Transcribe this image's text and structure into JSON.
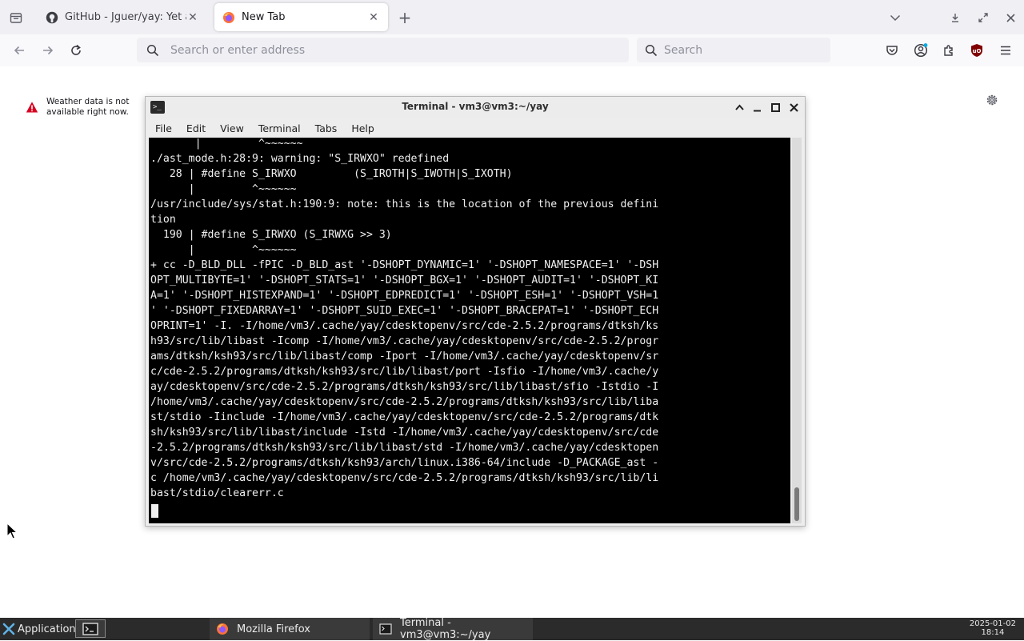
{
  "browser": {
    "tabs": [
      {
        "title": "GitHub - Jguer/yay: Yet another Yogurt - An AUR Helper written in Go",
        "favicon": "github-icon",
        "active": false
      },
      {
        "title": "New Tab",
        "favicon": "firefox-icon",
        "active": true
      }
    ],
    "urlbar": {
      "placeholder": "Search or enter address",
      "value": ""
    },
    "searchbar": {
      "placeholder": "Search",
      "value": ""
    },
    "toolbar_icons": [
      "back-icon",
      "forward-icon",
      "reload-icon",
      "pocket-icon",
      "account-icon",
      "extensions-icon",
      "ublock-icon",
      "menu-icon"
    ]
  },
  "newtab": {
    "weather_message": "Weather data is not available right now."
  },
  "terminal": {
    "title": "Terminal - vm3@vm3:~/yay",
    "menu": [
      "File",
      "Edit",
      "View",
      "Terminal",
      "Tabs",
      "Help"
    ],
    "lines": [
      "       |         ^~~~~~~",
      "./ast_mode.h:28:9: warning: \"S_IRWXO\" redefined",
      "   28 | #define S_IRWXO         (S_IROTH|S_IWOTH|S_IXOTH)",
      "      |         ^~~~~~~",
      "/usr/include/sys/stat.h:190:9: note: this is the location of the previous defini",
      "tion",
      "  190 | #define S_IRWXO (S_IRWXG >> 3)",
      "      |         ^~~~~~~",
      "+ cc -D_BLD_DLL -fPIC -D_BLD_ast '-DSHOPT_DYNAMIC=1' '-DSHOPT_NAMESPACE=1' '-DSH",
      "OPT_MULTIBYTE=1' '-DSHOPT_STATS=1' '-DSHOPT_BGX=1' '-DSHOPT_AUDIT=1' '-DSHOPT_KI",
      "A=1' '-DSHOPT_HISTEXPAND=1' '-DSHOPT_EDPREDICT=1' '-DSHOPT_ESH=1' '-DSHOPT_VSH=1",
      "' '-DSHOPT_FIXEDARRAY=1' '-DSHOPT_SUID_EXEC=1' '-DSHOPT_BRACEPAT=1' '-DSHOPT_ECH",
      "OPRINT=1' -I. -I/home/vm3/.cache/yay/cdesktopenv/src/cde-2.5.2/programs/dtksh/ks",
      "h93/src/lib/libast -Icomp -I/home/vm3/.cache/yay/cdesktopenv/src/cde-2.5.2/progr",
      "ams/dtksh/ksh93/src/lib/libast/comp -Iport -I/home/vm3/.cache/yay/cdesktopenv/sr",
      "c/cde-2.5.2/programs/dtksh/ksh93/src/lib/libast/port -Isfio -I/home/vm3/.cache/y",
      "ay/cdesktopenv/src/cde-2.5.2/programs/dtksh/ksh93/src/lib/libast/sfio -Istdio -I",
      "/home/vm3/.cache/yay/cdesktopenv/src/cde-2.5.2/programs/dtksh/ksh93/src/lib/liba",
      "st/stdio -Iinclude -I/home/vm3/.cache/yay/cdesktopenv/src/cde-2.5.2/programs/dtk",
      "sh/ksh93/src/lib/libast/include -Istd -I/home/vm3/.cache/yay/cdesktopenv/src/cde",
      "-2.5.2/programs/dtksh/ksh93/src/lib/libast/std -I/home/vm3/.cache/yay/cdesktopen",
      "v/src/cde-2.5.2/programs/dtksh/ksh93/arch/linux.i386-64/include -D_PACKAGE_ast -",
      "c /home/vm3/.cache/yay/cdesktopenv/src/cde-2.5.2/programs/dtksh/ksh93/src/lib/li",
      "bast/stdio/clearerr.c"
    ]
  },
  "taskbar": {
    "applications_label": "Applications",
    "tasks": [
      {
        "label": "Mozilla Firefox",
        "icon": "firefox-icon"
      },
      {
        "label": "Terminal - vm3@vm3:~/yay",
        "icon": "terminal-icon"
      }
    ],
    "clock_date": "2025-01-02",
    "clock_time": "18:14"
  },
  "colors": {
    "tabstrip_bg": "#f0f0f4",
    "terminal_bg": "#000000",
    "terminal_fg": "#f0f0f0",
    "panel_bg": "#2b2b2b",
    "warning_red": "#d70022",
    "ublock_red": "#800000"
  }
}
